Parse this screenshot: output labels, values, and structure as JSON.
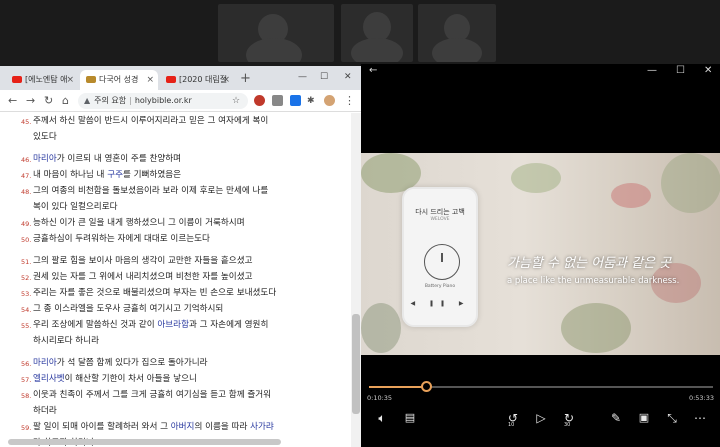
{
  "browser": {
    "tabs": [
      {
        "label": "[에노엔탐 애"
      },
      {
        "label": "다국어 성경"
      },
      {
        "label": "[2020 대림절"
      }
    ],
    "new_tab": "+",
    "window_buttons": {
      "minimize": "—",
      "maximize": "☐",
      "close": "✕"
    },
    "security_label": "주의 요함",
    "url": "holybible.or.kr",
    "verses": [
      {
        "num": "45.",
        "lines": [
          "주께서 하신 말씀이 반드시 이루어지리라고 믿은 그 여자에게 복이",
          "있도다"
        ]
      },
      {
        "num": "46.",
        "highlight": "마리아",
        "rest": "가 이르되 내 영혼이 주를 찬양하며"
      },
      {
        "num": "47.",
        "pre": "내 마음이 하나님 내 ",
        "highlight": "구주",
        "post": "를 기뻐하였음은"
      },
      {
        "num": "48.",
        "lines": [
          "그의 여종의 비천함을 돌보셨음이라 보라 이제 후로는 만세에 나를",
          "복이 있다 일컬으리로다"
        ]
      },
      {
        "num": "49.",
        "text": "능하신 이가 큰 일을 내게 행하셨으니 그 이름이 거룩하시며"
      },
      {
        "num": "50.",
        "text": "긍휼하심이 두려워하는 자에게 대대로 이르는도다"
      },
      {
        "num": "51.",
        "text": "그의 팔로 힘을 보이사 마음의 생각이 교만한 자들을 흩으셨고"
      },
      {
        "num": "52.",
        "text": "권세 있는 자를 그 위에서 내리치셨으며 비천한 자를 높이셨고"
      },
      {
        "num": "53.",
        "text": "주리는 자를 좋은 것으로 배불리셨으며 부자는 빈 손으로 보내셨도다"
      },
      {
        "num": "54.",
        "text": "그 종 이스라엘을 도우사 긍휼히 여기시고 기억하시되"
      },
      {
        "num": "55.",
        "pre": "우리 조상에게 말씀하신 것과 같이 ",
        "highlight": "아브라함",
        "post": "과 그 자손에게 영원히",
        "line2": "하시리로다 하니라"
      },
      {
        "num": "56.",
        "highlight": "마리아",
        "rest": "가 석 달쯤 함께 있다가 집으로 돌아가니라"
      },
      {
        "num": "57.",
        "highlight": "엘리사벳",
        "rest": "이 해산할 기한이 차서 아들을 낳으니"
      },
      {
        "num": "58.",
        "lines": [
          "이웃과 친족이 주께서 그를 크게 긍휼히 여기심을 듣고 함께 즐거워",
          "하더라"
        ]
      },
      {
        "num": "59.",
        "pre": "팔 일이 되매 아이를 할례하러 와서 그 ",
        "highlight": "아버지",
        "mid": "의 이름을 따라 ",
        "highlight2": "사가랴",
        "line2": "라 하고자 하더니"
      }
    ]
  },
  "player": {
    "back": "←",
    "window_buttons": {
      "minimize": "—",
      "maximize": "☐",
      "close": "✕"
    },
    "video": {
      "phone_title": "다시 드리는 고백",
      "phone_artist": "WELOVE",
      "phone_brand": "Battery Piano",
      "phone_controls": "◀ ❚❚ ▶",
      "caption_ko": "가늠할 수 없는 어둠과 같은 곳",
      "caption_en": "a place like the unmeasurable darkness."
    },
    "progress": 0.17,
    "time_current": "0:10:35",
    "time_total": "0:53:33",
    "skip_back": "10",
    "skip_forward": "30"
  }
}
